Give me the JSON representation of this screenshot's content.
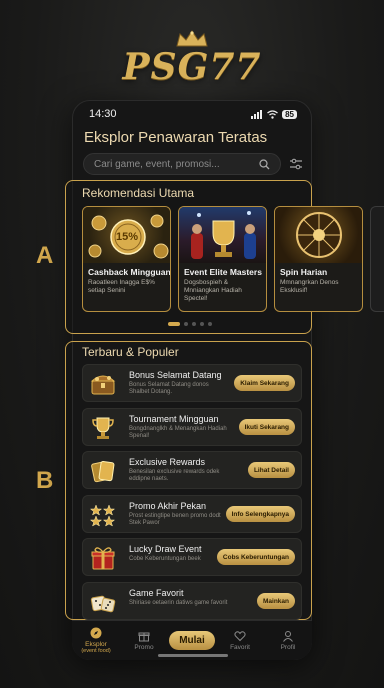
{
  "brand": {
    "logo_text": "PSG77"
  },
  "status_bar": {
    "time": "14:30",
    "battery": "85"
  },
  "header": {
    "title": "Eksplor Penawaran Teratas"
  },
  "search": {
    "placeholder": "Cari game, event, promosi..."
  },
  "section_labels": {
    "a": "A",
    "b": "B"
  },
  "recommendations": {
    "title": "Rekomendasi Utama",
    "cards": [
      {
        "title": "Cashback Mingguan",
        "desc": "Raoatleen Inagga E$% setiap Senini",
        "badge": "15%"
      },
      {
        "title": "Event Elite Masters",
        "desc": "Dogsbospieh & Mnniangkan Hadiah Spectel!"
      },
      {
        "title": "Spin Harian",
        "desc": "Mmnangrkan Denos Eksklusif!"
      }
    ],
    "carousel": {
      "pages": 5,
      "active": 0
    }
  },
  "popular": {
    "title": "Terbaru & Populer",
    "items": [
      {
        "title": "Bonus Selamat Datang",
        "desc": "Bonus Selamat Datang donos Shalbet Dotang.",
        "button": "Klaim Sekarang",
        "icon": "treasure-chest-icon"
      },
      {
        "title": "Tournament Mingguan",
        "desc": "Bongdnanglkh & Menangkan Hadiah Spenal!",
        "button": "Ikuti Sekarang",
        "icon": "trophy-icon"
      },
      {
        "title": "Exclusive Rewards",
        "desc": "Benesilan exclusive rewards odek eddipne naets.",
        "button": "Lihat Detail",
        "icon": "gold-cards-icon"
      },
      {
        "title": "Promo Akhir Pekan",
        "desc": "Prost estingtipe benen promo dodt Stek Pawor",
        "button": "Info Selengkapnya",
        "icon": "stars-icon"
      },
      {
        "title": "Lucky Draw Event",
        "desc": "Cobe Keberuntungan beek",
        "button": "Cobs Keberuntungan",
        "icon": "gift-icon"
      },
      {
        "title": "Game Favorit",
        "desc": "Shiriase oetaerin datiws game favorit",
        "button": "Mainkan",
        "icon": "dice-icon"
      }
    ]
  },
  "nav": {
    "items": [
      {
        "label": "Eksplor",
        "sublabel": "(event food)",
        "icon": "compass-icon",
        "active": true
      },
      {
        "label": "Promo",
        "icon": "gift-box-icon"
      },
      {
        "label": "Mulai",
        "icon": "play-icon"
      },
      {
        "label": "Favorit",
        "icon": "heart-icon"
      },
      {
        "label": "Profil",
        "icon": "user-icon"
      }
    ]
  },
  "colors": {
    "gold": "#d4a94e",
    "background": "#1a1a19"
  }
}
